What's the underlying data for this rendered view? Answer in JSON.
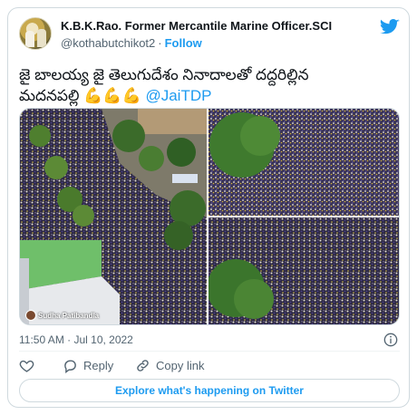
{
  "author": {
    "display_name": "K.B.K.Rao. Former Mercantile Marine Officer.SCI",
    "handle": "@kothabutchikot2",
    "separator": "·",
    "follow_label": "Follow"
  },
  "tweet": {
    "text_line1": "జై బాలయ్య జై తెలుగుదేశం నినాదాలతో దద్దరిల్లిన",
    "text_line2": "మదనపల్లి",
    "emojis": "💪💪💪",
    "mention": "@JaiTDP"
  },
  "media": {
    "credit": "Sudha Patibandla",
    "photo_count": 3
  },
  "meta": {
    "timestamp": "11:50 AM · Jul 10, 2022"
  },
  "actions": {
    "like_count": "",
    "reply_label": "Reply",
    "copy_link_label": "Copy link"
  },
  "explore": {
    "label": "Explore what's happening on Twitter"
  },
  "colors": {
    "twitter_blue": "#1d9bf0",
    "text_primary": "#0f1419",
    "text_secondary": "#536471",
    "border": "#cfd9de"
  },
  "icons": {
    "brand": "twitter-bird-icon",
    "info": "info-icon",
    "like": "heart-icon",
    "reply": "speech-bubble-icon",
    "copy_link": "link-icon"
  }
}
